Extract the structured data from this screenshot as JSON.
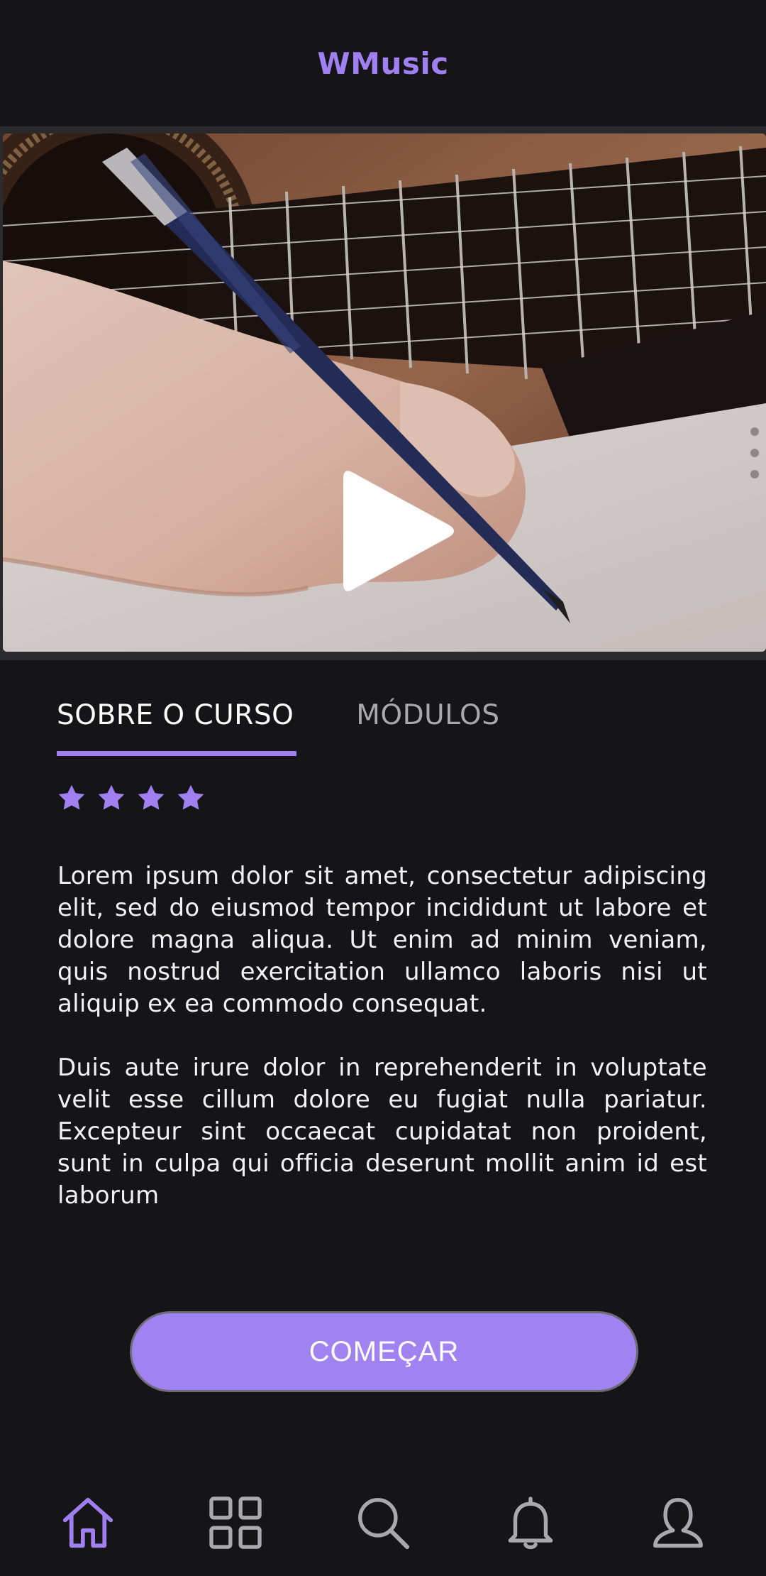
{
  "app": {
    "title": "WMusic",
    "accent_color": "#a07ff0",
    "background_color": "#151416"
  },
  "video": {
    "thumbnail_description_icon": "play-icon",
    "state": "paused"
  },
  "tabs": [
    {
      "label": "SOBRE O CURSO",
      "active": true
    },
    {
      "label": "MÓDULOS",
      "active": false
    }
  ],
  "rating": {
    "stars": 4,
    "icon": "star-icon"
  },
  "description": {
    "paragraph_1": "Lorem ipsum dolor sit amet, consectetur adipiscing elit, sed do eiusmod tempor incididunt ut labore et dolore magna aliqua. Ut enim ad minim veniam, quis nostrud exercitation ullamco laboris nisi ut aliquip ex ea commodo consequat.",
    "paragraph_2": "Duis aute irure dolor in reprehenderit in voluptate velit esse cillum dolore eu fugiat nulla pariatur. Excepteur sint occaecat cupidatat non proident, sunt in culpa qui officia deserunt mollit anim id est laborum"
  },
  "cta": {
    "label": "COMEÇAR"
  },
  "bottom_nav": [
    {
      "icon": "home-icon",
      "active": true
    },
    {
      "icon": "grid-icon",
      "active": false
    },
    {
      "icon": "search-icon",
      "active": false
    },
    {
      "icon": "bell-icon",
      "active": false
    },
    {
      "icon": "user-icon",
      "active": false
    }
  ]
}
